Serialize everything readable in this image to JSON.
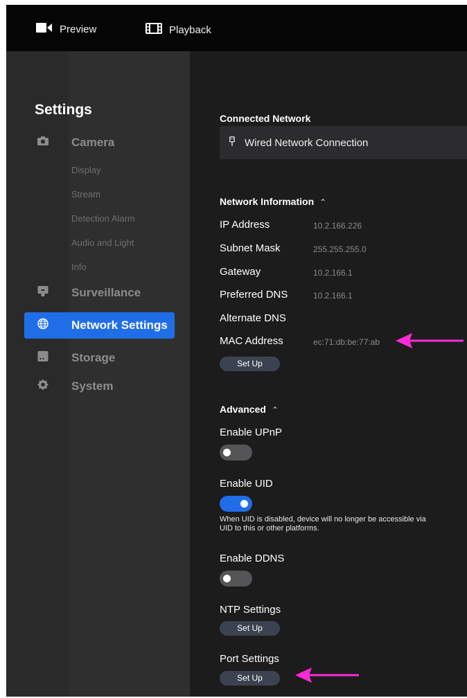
{
  "topbar": {
    "preview_label": "Preview",
    "playback_label": "Playback",
    "preview_icon": "video-camera-icon",
    "playback_icon": "film-icon"
  },
  "sidebar": {
    "title": "Settings",
    "items": [
      {
        "label": "Camera",
        "icon": "camera-icon",
        "active": false
      },
      {
        "label": "Surveillance",
        "icon": "monitor-icon",
        "active": false
      },
      {
        "label": "Network Settings",
        "icon": "globe-icon",
        "active": true
      },
      {
        "label": "Storage",
        "icon": "storage-icon",
        "active": false
      },
      {
        "label": "System",
        "icon": "gear-icon",
        "active": false
      }
    ],
    "camera_subitems": [
      "Display",
      "Stream",
      "Detection Alarm",
      "Audio and Light",
      "Info"
    ]
  },
  "main": {
    "connected_network": {
      "title": "Connected Network",
      "connection_name": "Wired Network Connection"
    },
    "network_information": {
      "title": "Network Information",
      "rows": [
        {
          "label": "IP Address",
          "value": "10.2.166.226"
        },
        {
          "label": "Subnet Mask",
          "value": "255.255.255.0"
        },
        {
          "label": "Gateway",
          "value": "10.2.166.1"
        },
        {
          "label": "Preferred DNS",
          "value": "10.2.166.1"
        },
        {
          "label": "Alternate DNS",
          "value": ""
        },
        {
          "label": "MAC Address",
          "value": "ec:71:db:be:77:ab"
        }
      ],
      "setup_label": "Set Up"
    },
    "advanced": {
      "title": "Advanced",
      "enable_upnp": {
        "label": "Enable UPnP",
        "enabled": false
      },
      "enable_uid": {
        "label": "Enable UID",
        "enabled": true,
        "note": "When UID is disabled, device will no longer be accessible via UID to this or other platforms."
      },
      "enable_ddns": {
        "label": "Enable DDNS",
        "enabled": false
      },
      "ntp_settings": {
        "label": "NTP Settings",
        "button": "Set Up"
      },
      "port_settings": {
        "label": "Port Settings",
        "button": "Set Up"
      }
    }
  },
  "colors": {
    "accent": "#1f6ee8",
    "annotation_arrow": "#ff2bd6"
  }
}
